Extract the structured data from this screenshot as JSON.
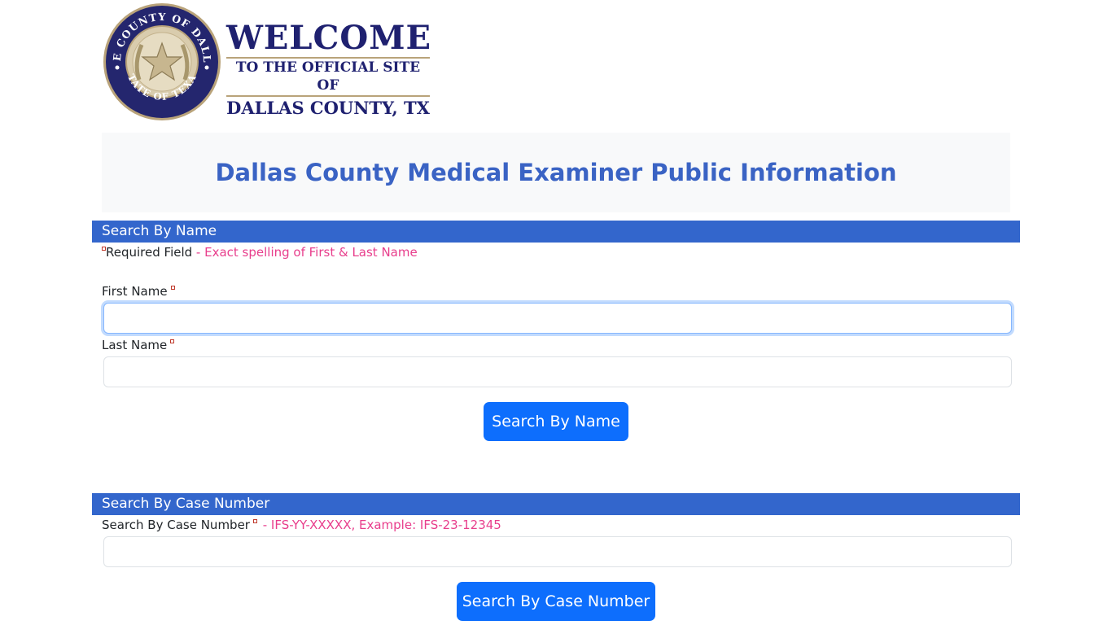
{
  "header": {
    "seal_text_top": "THE COUNTY OF DALLAS",
    "seal_text_bottom": "STATE OF TEXAS",
    "welcome": "WELCOME",
    "welcome_sub": "TO THE OFFICIAL SITE OF",
    "welcome_county": "DALLAS COUNTY, TX"
  },
  "page_title": "Dallas County Medical Examiner Public Information",
  "name_search": {
    "section_label": "Search By Name",
    "required_text": "Required Field",
    "required_hint": " - Exact spelling of First & Last Name",
    "first_name_label": "First Name",
    "first_name_value": "",
    "last_name_label": "Last Name",
    "last_name_value": "",
    "button_label": "Search By Name"
  },
  "case_search": {
    "section_label": "Search By Case Number",
    "field_label": "Search By Case Number",
    "field_hint": " - IFS-YY-XXXXX, Example: IFS-23-12345",
    "field_value": "",
    "button_label": "Search By Case Number"
  },
  "colors": {
    "brand_navy": "#1f2170",
    "section_bar": "#3366cc",
    "title_blue": "#3a63c4",
    "button_blue": "#0d6efd",
    "hint_pink": "#e83e8c"
  }
}
